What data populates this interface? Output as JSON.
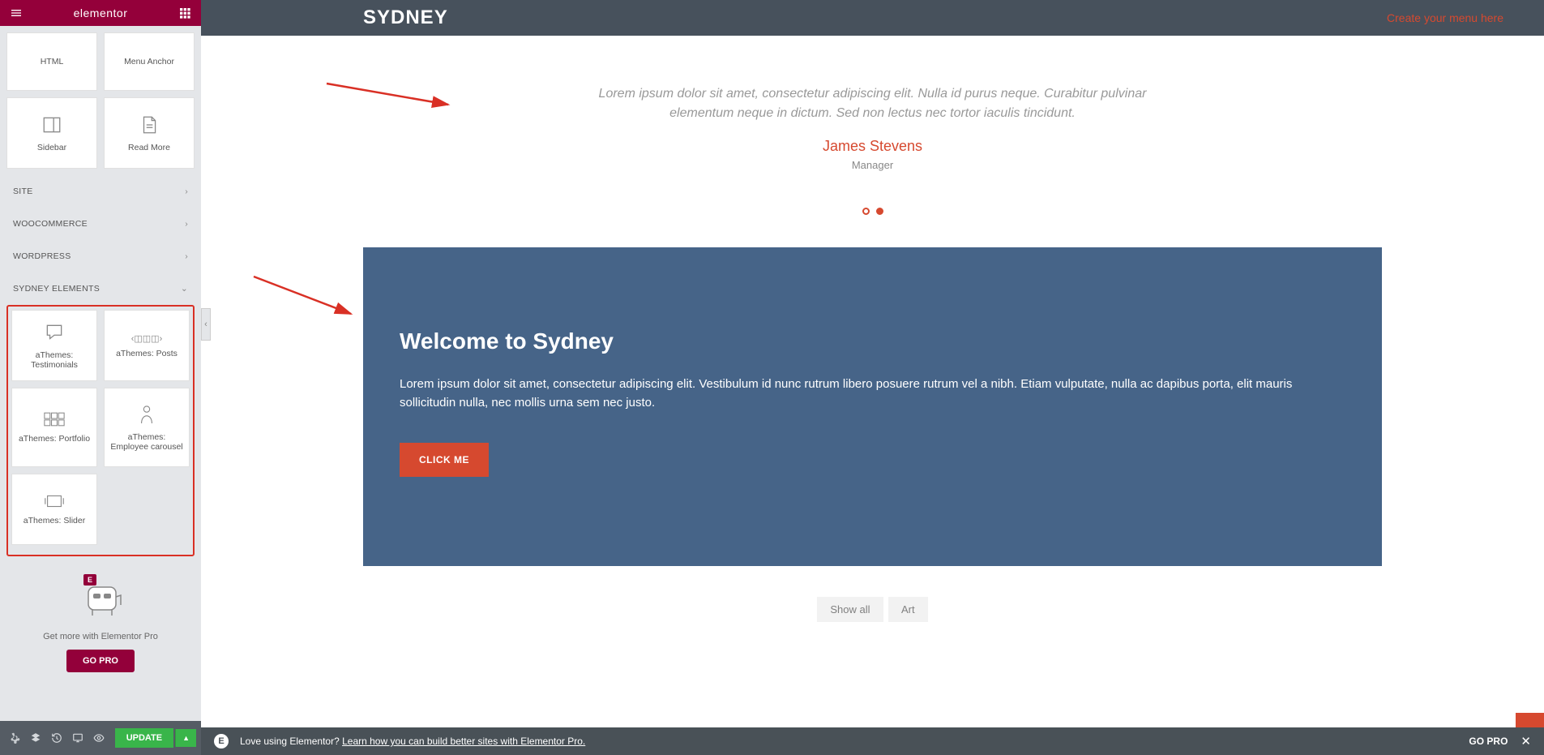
{
  "sidebar": {
    "title": "elementor",
    "widgets_top": [
      {
        "label": "HTML"
      },
      {
        "label": "Menu Anchor"
      },
      {
        "label": "Sidebar"
      },
      {
        "label": "Read More"
      }
    ],
    "categories": [
      {
        "label": "SITE"
      },
      {
        "label": "WOOCOMMERCE"
      },
      {
        "label": "WORDPRESS"
      },
      {
        "label": "SYDNEY ELEMENTS"
      }
    ],
    "sydney_widgets": [
      {
        "label": "aThemes: Testimonials"
      },
      {
        "label": "aThemes: Posts"
      },
      {
        "label": "aThemes: Portfolio"
      },
      {
        "label": "aThemes: Employee carousel"
      },
      {
        "label": "aThemes: Slider"
      }
    ],
    "pro_text": "Get more with Elementor Pro",
    "go_pro": "GO PRO",
    "update": "UPDATE"
  },
  "preview": {
    "logo": "SYDNEY",
    "menu_link": "Create your menu here",
    "testimonial": {
      "text": "Lorem ipsum dolor sit amet, consectetur adipiscing elit. Nulla id purus neque. Curabitur pulvinar elementum neque in dictum. Sed non lectus nec tortor iaculis tincidunt.",
      "name": "James Stevens",
      "role": "Manager"
    },
    "cta": {
      "title": "Welcome to Sydney",
      "text": "Lorem ipsum dolor sit amet, consectetur adipiscing elit. Vestibulum id nunc rutrum libero posuere rutrum vel a nibh. Etiam vulputate, nulla ac dapibus porta, elit mauris sollicitudin nulla, nec mollis urna sem nec justo.",
      "button": "CLICK ME"
    },
    "filters": [
      {
        "label": "Show all"
      },
      {
        "label": "Art"
      }
    ]
  },
  "bottombar": {
    "prompt": "Love using Elementor?",
    "link": "Learn how you can build better sites with Elementor Pro.",
    "go_pro": "GO PRO"
  }
}
